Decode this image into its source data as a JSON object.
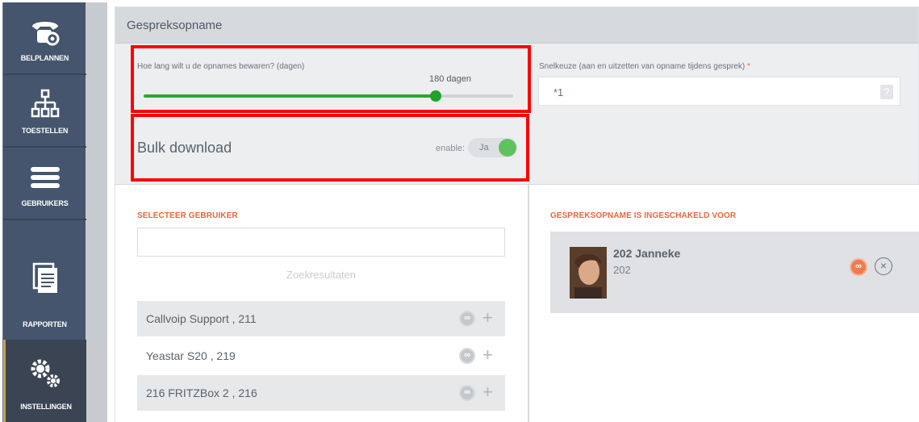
{
  "sidebar": {
    "items": [
      {
        "label": "BELPLANNEN",
        "icon": "phone-gear-icon"
      },
      {
        "label": "TOESTELLEN",
        "icon": "hierarchy-icon"
      },
      {
        "label": "GEBRUIKERS",
        "icon": "hamburger-icon"
      },
      {
        "label": "RAPPORTEN",
        "icon": "document-icon"
      },
      {
        "label": "INSTELLINGEN",
        "icon": "gears-icon"
      }
    ],
    "active": "INSTELLINGEN"
  },
  "header": {
    "title": "Gespreksopname"
  },
  "retention": {
    "label": "Hoe lang wilt u de opnames bewaren? (dagen)",
    "value_label": "180 dagen",
    "value": 180,
    "fill_fraction": 0.79
  },
  "shortcut": {
    "label": "Snelkeuze (aan en uitzetten van opname tijdens gesprek)",
    "required_mark": "*",
    "value": "*1",
    "help": "?"
  },
  "bulk": {
    "title": "Bulk download",
    "enable_label": "enable:",
    "toggle_text": "Ja",
    "enabled": true
  },
  "select_user": {
    "title": "SELECTEER GEBRUIKER",
    "search_value": "",
    "results_label": "Zoekresultaten",
    "results": [
      {
        "name": "Callvoip Support , 211"
      },
      {
        "name": "Yeastar S20 , 219"
      },
      {
        "name": "216 FRITZBox 2 , 216"
      }
    ],
    "add_symbol": "+"
  },
  "enabled_for": {
    "title": "GESPREKSOPNAME IS INGESCHAKELD VOOR",
    "users": [
      {
        "name": "202 Janneke",
        "ext": "202",
        "remove_symbol": "×"
      }
    ]
  },
  "colors": {
    "sidebar": "#44556d",
    "accent_orange": "#e8663d",
    "slider_green": "#2fa52f",
    "toggle_green": "#5fc25f",
    "highlight_red": "#ff0000"
  }
}
